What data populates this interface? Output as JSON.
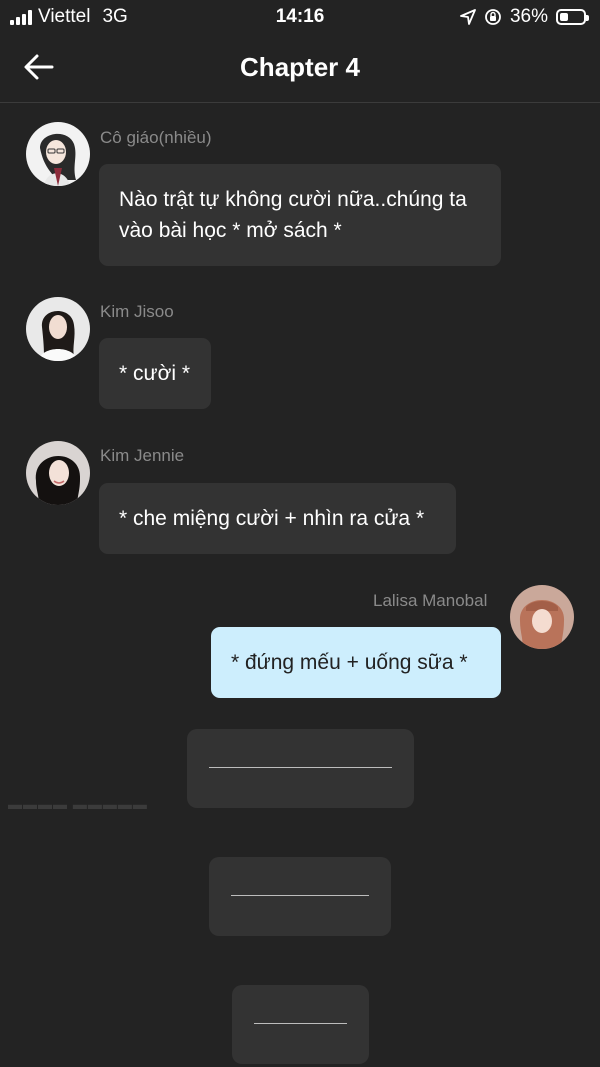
{
  "status_bar": {
    "carrier": "Viettel",
    "network": "3G",
    "time": "14:16",
    "battery": "36%",
    "battery_level": 0.36
  },
  "header": {
    "title": "Chapter 4",
    "back_icon": "arrow-left-icon"
  },
  "messages": [
    {
      "sender": "Cô giáo(nhiều)",
      "text": "Nào trật tự không cười nữa..chúng ta vào bài học * mở sách *"
    },
    {
      "sender": "Kim Jisoo",
      "text": "* cười *"
    },
    {
      "sender": "Kim Jennie",
      "text": "* che miệng cười + nhìn ra cửa *"
    },
    {
      "sender": "Lalisa Manobal",
      "text": "* đứng mếu + uống sữa *"
    }
  ],
  "dividers": [
    {
      "label": "divider-long"
    },
    {
      "label": "divider-medium"
    },
    {
      "label": "divider-short"
    }
  ],
  "colors": {
    "background": "#232323",
    "bubble": "#333333",
    "own_bubble": "#cdeefd",
    "sender_name": "#8a8a8a"
  }
}
